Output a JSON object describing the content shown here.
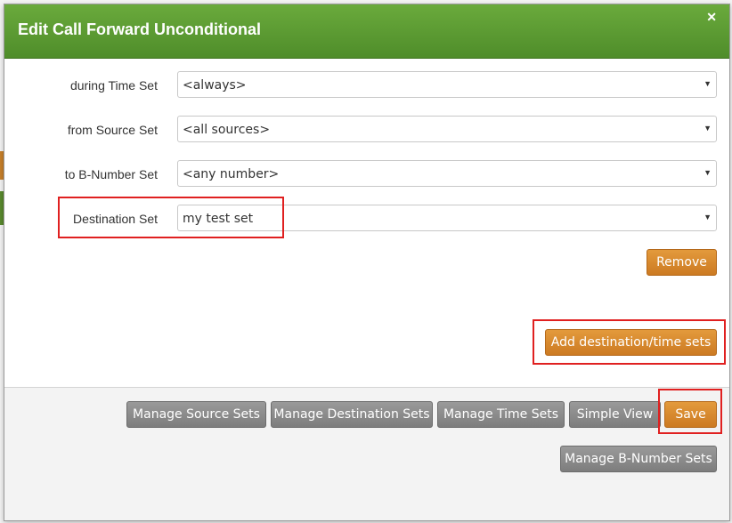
{
  "dialog": {
    "title": "Edit Call Forward Unconditional",
    "close_icon": "close-icon",
    "close_glyph": "✕"
  },
  "form": {
    "time_set": {
      "label": "during Time Set",
      "value": "<always>"
    },
    "source_set": {
      "label": "from Source Set",
      "value": "<all sources>"
    },
    "bnumber_set": {
      "label": "to B-Number Set",
      "value": "<any number>"
    },
    "destination_set": {
      "label": "Destination Set",
      "value": "my test set"
    },
    "dropdown_glyph": "▼"
  },
  "buttons": {
    "remove": "Remove",
    "add_sets": "Add destination/time sets",
    "manage_source_sets": "Manage Source Sets",
    "manage_destination_sets": "Manage Destination Sets",
    "manage_time_sets": "Manage Time Sets",
    "simple_view": "Simple View",
    "save": "Save",
    "manage_bnumber_sets": "Manage B-Number Sets"
  },
  "colors": {
    "header_green": "#5b9b32",
    "primary_orange": "#d5842b",
    "secondary_gray": "#8a8a8a",
    "highlight_red": "#e02020"
  }
}
